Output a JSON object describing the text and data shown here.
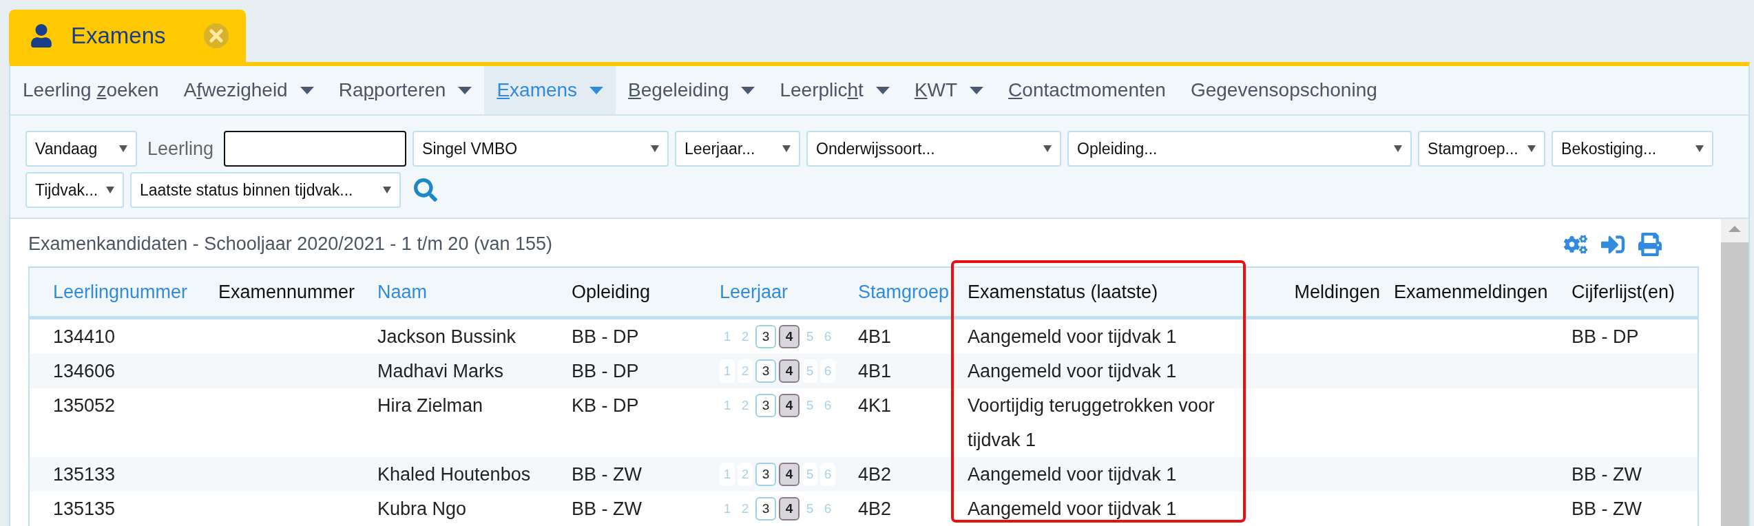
{
  "tab": {
    "title": "Examens",
    "closable": true
  },
  "menu": [
    {
      "before": "Leerling ",
      "key": "z",
      "after": "oeken",
      "dropdown": false,
      "selected": false
    },
    {
      "before": "A",
      "key": "f",
      "after": "wezigheid",
      "dropdown": true,
      "selected": false
    },
    {
      "before": "Ra",
      "key": "p",
      "after": "porteren",
      "dropdown": true,
      "selected": false
    },
    {
      "key": "E",
      "after": "xamens",
      "dropdown": true,
      "selected": true
    },
    {
      "key": "B",
      "after": "egeleiding",
      "dropdown": true,
      "selected": false
    },
    {
      "before": "Leerplic",
      "key": "h",
      "after": "t",
      "dropdown": true,
      "selected": false
    },
    {
      "key": "K",
      "after": "WT",
      "dropdown": true,
      "selected": false
    },
    {
      "key": "C",
      "after": "ontactmomenten",
      "dropdown": false,
      "selected": false
    },
    {
      "before": "Gegevensopschoning",
      "dropdown": false,
      "selected": false
    }
  ],
  "filters": [
    [
      {
        "kind": "select",
        "value": "Vandaag"
      },
      {
        "kind": "label",
        "text": "Leerling"
      },
      {
        "kind": "input"
      },
      {
        "kind": "select",
        "value": "Singel VMBO"
      },
      {
        "kind": "select",
        "value": "Leerjaar..."
      },
      {
        "kind": "select",
        "value": "Onderwijssoort..."
      },
      {
        "kind": "select",
        "value": "Opleiding..."
      },
      {
        "kind": "select",
        "value": "Stamgroep..."
      },
      {
        "kind": "select",
        "value": "Bekostiging..."
      }
    ],
    [
      {
        "kind": "select",
        "value": "Tijdvak..."
      },
      {
        "kind": "select",
        "value": "Laatste status binnen tijdvak..."
      },
      {
        "kind": "search"
      }
    ]
  ],
  "heading": "Examenkandidaten - Schooljaar 2020/2021 - 1 t/m 20 (van 155)",
  "table": {
    "columns": [
      {
        "label": "Leerlingnummer",
        "sortable": true
      },
      {
        "label": "Examennummer",
        "sortable": false
      },
      {
        "label": "Naam",
        "sortable": true
      },
      {
        "label": "Opleiding",
        "sortable": false
      },
      {
        "label": "Leerjaar",
        "sortable": true
      },
      {
        "label": "Stamgroep",
        "sortable": true
      },
      {
        "label": "Examenstatus (laatste)",
        "sortable": false,
        "highlighted": true
      },
      {
        "label": "Meldingen",
        "sortable": false
      },
      {
        "label": "Examenmeldingen",
        "sortable": false
      },
      {
        "label": "Cijferlijst(en)",
        "sortable": false
      }
    ],
    "rows": [
      {
        "leerlingnummer": "134410",
        "naam": "Jackson Bussink",
        "opleiding": "BB - DP",
        "years": [
          {
            "label": "1",
            "kind": "plain"
          },
          {
            "label": "2",
            "kind": "plain"
          },
          {
            "label": "3",
            "kind": "past"
          },
          {
            "label": "4",
            "kind": "current"
          },
          {
            "label": "5",
            "kind": "plain"
          },
          {
            "label": "6",
            "kind": "plain"
          }
        ],
        "stamgroep": "4B1",
        "status": "Aangemeld voor tijdvak 1",
        "cijferlijst": "BB - DP"
      },
      {
        "leerlingnummer": "134606",
        "naam": "Madhavi Marks",
        "opleiding": "BB - DP",
        "years": [
          {
            "label": "1",
            "kind": "plain"
          },
          {
            "label": "2",
            "kind": "plain"
          },
          {
            "label": "3",
            "kind": "past"
          },
          {
            "label": "4",
            "kind": "current"
          },
          {
            "label": "5",
            "kind": "plain"
          },
          {
            "label": "6",
            "kind": "plain"
          }
        ],
        "stamgroep": "4B1",
        "status": "Aangemeld voor tijdvak 1"
      },
      {
        "leerlingnummer": "135052",
        "naam": "Hira Zielman",
        "opleiding": "KB - DP",
        "years": [
          {
            "label": "1",
            "kind": "plain"
          },
          {
            "label": "2",
            "kind": "plain"
          },
          {
            "label": "3",
            "kind": "past"
          },
          {
            "label": "4",
            "kind": "current"
          },
          {
            "label": "5",
            "kind": "plain"
          },
          {
            "label": "6",
            "kind": "plain"
          }
        ],
        "stamgroep": "4K1",
        "status": "Voortijdig teruggetrokken voor tijdvak 1"
      },
      {
        "leerlingnummer": "135133",
        "naam": "Khaled Houtenbos",
        "opleiding": "BB - ZW",
        "years": [
          {
            "label": "1",
            "kind": "plain"
          },
          {
            "label": "2",
            "kind": "plain"
          },
          {
            "label": "3",
            "kind": "past"
          },
          {
            "label": "4",
            "kind": "current"
          },
          {
            "label": "5",
            "kind": "plain"
          },
          {
            "label": "6",
            "kind": "plain"
          }
        ],
        "stamgroep": "4B2",
        "status": "Aangemeld voor tijdvak 1",
        "cijferlijst": "BB - ZW"
      },
      {
        "leerlingnummer": "135135",
        "naam": "Kubra Ngo",
        "opleiding": "BB - ZW",
        "years": [
          {
            "label": "1",
            "kind": "plain"
          },
          {
            "label": "2",
            "kind": "plain"
          },
          {
            "label": "3",
            "kind": "past"
          },
          {
            "label": "4",
            "kind": "current"
          },
          {
            "label": "5",
            "kind": "plain"
          },
          {
            "label": "6",
            "kind": "plain"
          }
        ],
        "stamgroep": "4B2",
        "status": "Aangemeld voor tijdvak 1",
        "cijferlijst": "BB - ZW"
      }
    ]
  }
}
